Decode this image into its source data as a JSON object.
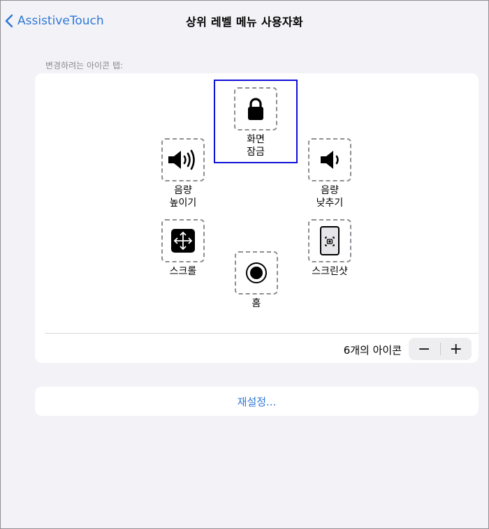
{
  "nav": {
    "back_label": "AssistiveTouch",
    "title": "상위 레벨 메뉴 사용자화"
  },
  "section": {
    "header": "변경하려는 아이콘 탭:"
  },
  "icons": [
    {
      "label": "화면\n잠금",
      "icon": "lock-icon",
      "selected": true
    },
    {
      "label": "음량\n높이기",
      "icon": "volume-up-icon"
    },
    {
      "label": "음량\n낮추기",
      "icon": "volume-down-icon"
    },
    {
      "label": "스크롤",
      "icon": "scroll-icon"
    },
    {
      "label": "스크린샷",
      "icon": "screenshot-icon"
    },
    {
      "label": "홈",
      "icon": "home-icon"
    }
  ],
  "footer": {
    "count_label": "6개의 아이콘",
    "minus": "−",
    "plus": "+"
  },
  "reset": {
    "label": "재설정..."
  },
  "colors": {
    "accent": "#2f78d6",
    "selection": "#1010d8",
    "background": "#f2f2f7"
  }
}
